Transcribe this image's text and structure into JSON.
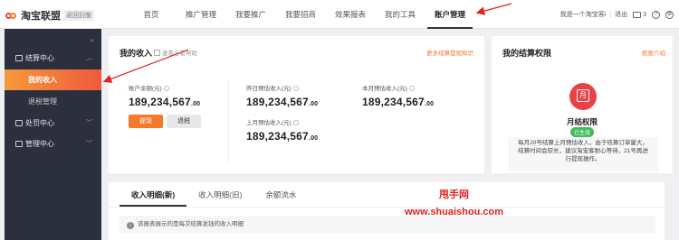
{
  "topbar": {
    "logo_text": "淘宝联盟",
    "old_version": "返回旧版",
    "nav": [
      "首页",
      "推广管理",
      "我要推广",
      "我要招商",
      "效果报表",
      "我的工具",
      "账户管理"
    ],
    "active_nav": "账户管理",
    "user_name": "我是一个淘宝客i",
    "logout": "退出",
    "mail_count": "3"
  },
  "sidebar": {
    "groups": [
      {
        "label": "结算中心",
        "items": [
          "我的收入",
          "退税管理"
        ],
        "active": "我的收入"
      },
      {
        "label": "处罚中心",
        "items": []
      },
      {
        "label": "管理中心",
        "items": []
      }
    ]
  },
  "income": {
    "title": "我的收入",
    "help": "查看必看帮助",
    "link": "更多结算提现知识",
    "balance_label": "账户余额(元)",
    "balance_int": "189,234,567",
    "balance_dec": ".00",
    "yesterday_label": "昨日预估收入(元)",
    "yesterday_int": "189,234,567",
    "yesterday_dec": ".00",
    "month_label": "本月预估收入(元)",
    "month_int": "189,234,567",
    "month_dec": ".00",
    "lastmonth_label": "上月预估收入(元)",
    "lastmonth_int": "189,234,567",
    "lastmonth_dec": ".00",
    "withdraw_button": "提现",
    "tax_button": "退税"
  },
  "rights": {
    "title": "我的结算权限",
    "link": "权限介绍",
    "icon_glyph": "月",
    "name": "月结权限",
    "tag": "已生效",
    "desc": "每月20号结算上月预估收入，由于结算订单量大，结算时间会较长，建议淘宝客耐心等待，21号再进行提现操作。"
  },
  "detail": {
    "tabs": [
      "收入明细(新)",
      "收入明细(旧)",
      "余额流水"
    ],
    "active_tab": "收入明细(新)",
    "notice": "该报表展示的是每次结算发钱的收入明细"
  },
  "watermark": {
    "line1": "甩手网",
    "line2": "www.shuaishou.com"
  },
  "colors": {
    "accent": "#f5792a",
    "sidebar_bg": "#2b2f3e",
    "arrow": "#e02222"
  }
}
